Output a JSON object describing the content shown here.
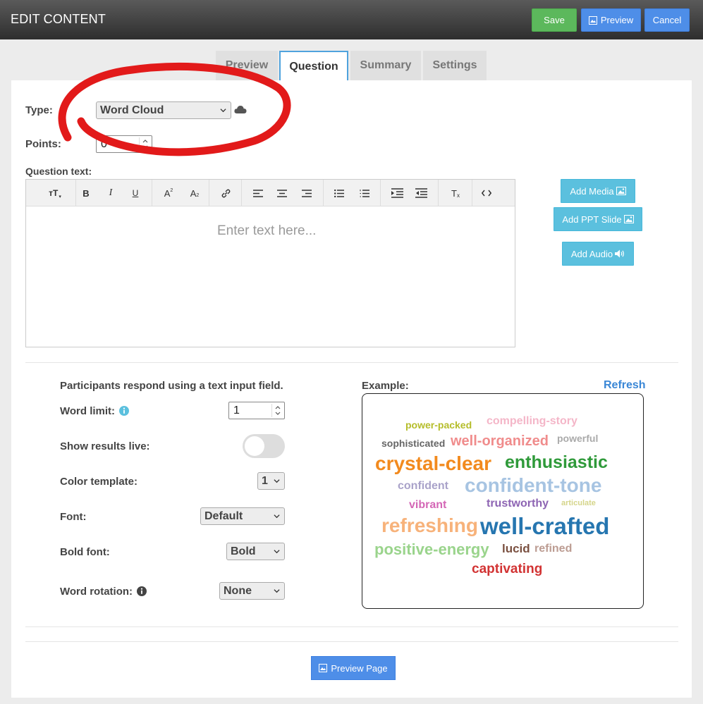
{
  "header": {
    "title": "EDIT CONTENT",
    "save_label": "Save",
    "preview_label": "Preview",
    "cancel_label": "Cancel"
  },
  "tabs": [
    {
      "label": "Preview",
      "active": false
    },
    {
      "label": "Question",
      "active": true
    },
    {
      "label": "Summary",
      "active": false
    },
    {
      "label": "Settings",
      "active": false
    }
  ],
  "form": {
    "type_label": "Type:",
    "type_value": "Word Cloud",
    "points_label": "Points:",
    "points_value": "0",
    "question_text_label": "Question text:",
    "editor_placeholder": "Enter text here...",
    "add_media": "Add Media",
    "add_ppt": "Add PPT Slide",
    "add_audio": "Add Audio"
  },
  "options": {
    "intro": "Participants respond using a text input field.",
    "word_limit_label": "Word limit:",
    "word_limit_value": "1",
    "show_results_label": "Show results live:",
    "show_results_on": false,
    "color_template_label": "Color template:",
    "color_template_value": "1",
    "font_label": "Font:",
    "font_value": "Default",
    "bold_font_label": "Bold font:",
    "bold_font_value": "Bold",
    "word_rotation_label": "Word rotation:",
    "word_rotation_value": "None"
  },
  "example": {
    "label": "Example:",
    "refresh": "Refresh",
    "words": [
      {
        "text": "power-packed",
        "color": "#b5bd2a"
      },
      {
        "text": "compelling-story",
        "color": "#f4b6c8"
      },
      {
        "text": "sophisticated",
        "color": "#666666"
      },
      {
        "text": "well-organized",
        "color": "#f08c8c"
      },
      {
        "text": "powerful",
        "color": "#aaaaaa"
      },
      {
        "text": "crystal-clear",
        "color": "#f28a1e"
      },
      {
        "text": "enthusiastic",
        "color": "#2f9a3a"
      },
      {
        "text": "confident",
        "color": "#a9a2c9"
      },
      {
        "text": "confident-tone",
        "color": "#a7c4e2"
      },
      {
        "text": "vibrant",
        "color": "#d467b6"
      },
      {
        "text": "trustworthy",
        "color": "#8d64b3"
      },
      {
        "text": "articulate",
        "color": "#d5d58a"
      },
      {
        "text": "refreshing",
        "color": "#f7b27a"
      },
      {
        "text": "well-crafted",
        "color": "#2676b0"
      },
      {
        "text": "positive-energy",
        "color": "#9ad48c"
      },
      {
        "text": "lucid",
        "color": "#7a5040"
      },
      {
        "text": "refined",
        "color": "#bc9c92"
      },
      {
        "text": "captivating",
        "color": "#d23333"
      }
    ]
  },
  "footer": {
    "preview_page": "Preview Page"
  }
}
